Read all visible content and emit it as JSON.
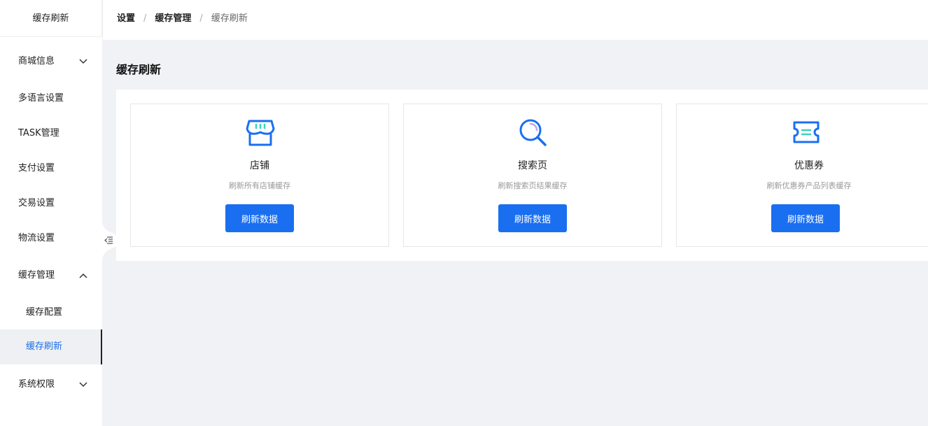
{
  "sidebar": {
    "title": "缓存刷新",
    "items": [
      {
        "label": "商城信息",
        "chevron": "down"
      },
      {
        "label": "多语言设置"
      },
      {
        "label": "TASK管理"
      },
      {
        "label": "支付设置"
      },
      {
        "label": "交易设置"
      },
      {
        "label": "物流设置"
      },
      {
        "label": "缓存管理",
        "chevron": "up"
      },
      {
        "label": "缓存配置"
      },
      {
        "label": "缓存刷新",
        "active": true
      },
      {
        "label": "系统权限",
        "chevron": "down"
      }
    ]
  },
  "breadcrumb": [
    "设置",
    "缓存管理",
    "缓存刷新"
  ],
  "page_title": "缓存刷新",
  "cards": [
    {
      "name": "店铺",
      "desc": "刷新所有店铺缓存",
      "button": "刷新数据",
      "icon": "shop-icon"
    },
    {
      "name": "搜索页",
      "desc": "刷新搜索页结果缓存",
      "button": "刷新数据",
      "icon": "search-icon"
    },
    {
      "name": "优惠券",
      "desc": "刷新优惠券产品列表缓存",
      "button": "刷新数据",
      "icon": "coupon-icon"
    }
  ],
  "colors": {
    "primary": "#1a6ff0",
    "accent": "#3ad4b8",
    "active_bg": "#eef0f4"
  }
}
